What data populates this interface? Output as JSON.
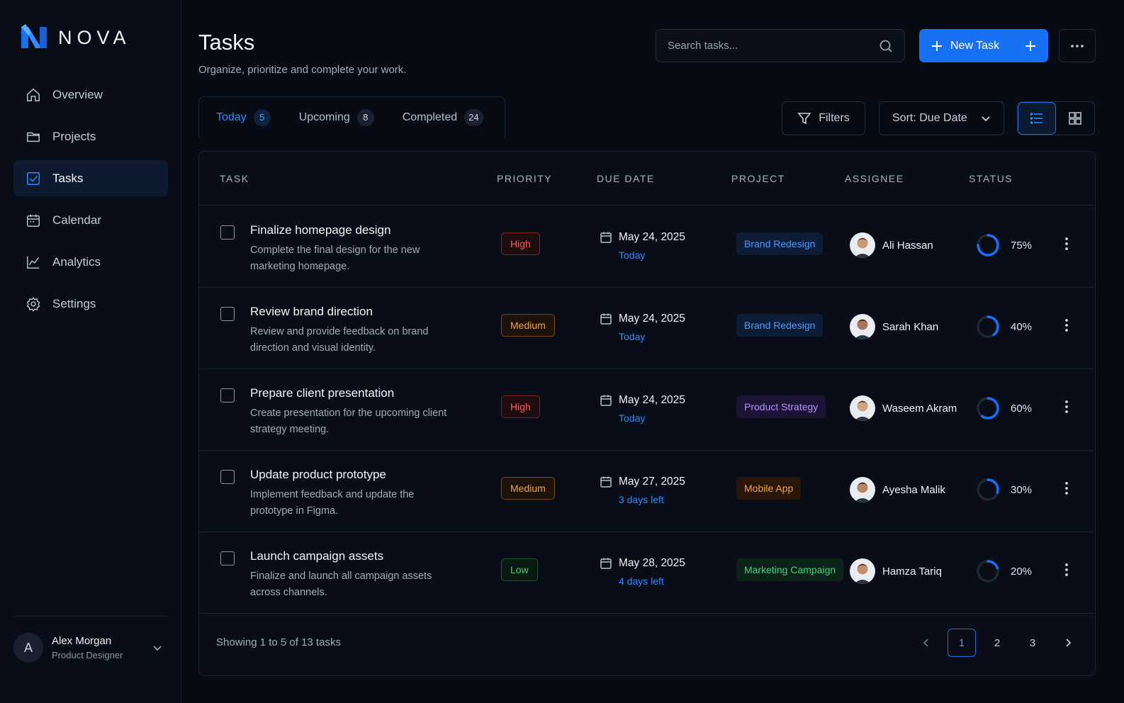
{
  "brand": {
    "name": "NOVA"
  },
  "sidebar": {
    "items": [
      {
        "label": "Overview",
        "icon": "home-icon"
      },
      {
        "label": "Projects",
        "icon": "folder-icon"
      },
      {
        "label": "Tasks",
        "icon": "checkbox-icon",
        "active": true
      },
      {
        "label": "Calendar",
        "icon": "calendar-icon"
      },
      {
        "label": "Analytics",
        "icon": "chart-icon"
      },
      {
        "label": "Settings",
        "icon": "gear-icon"
      }
    ],
    "user": {
      "initial": "A",
      "name": "Alex Morgan",
      "role": "Product Designer"
    }
  },
  "header": {
    "title": "Tasks",
    "subtitle": "Organize, prioritize and complete your work.",
    "search_placeholder": "Search tasks...",
    "new_task_label": "New Task"
  },
  "tabs": [
    {
      "label": "Today",
      "count": "5",
      "active": true
    },
    {
      "label": "Upcoming",
      "count": "8"
    },
    {
      "label": "Completed",
      "count": "24"
    }
  ],
  "toolbar": {
    "filters_label": "Filters",
    "sort_label": "Sort: Due Date"
  },
  "table": {
    "columns": [
      "TASK",
      "PRIORITY",
      "DUE DATE",
      "PROJECT",
      "ASSIGNEE",
      "STATUS"
    ],
    "rows": [
      {
        "title": "Finalize homepage design",
        "desc": "Complete the final design for the new marketing homepage.",
        "priority": "High",
        "due": "May 24, 2025",
        "due_rel": "Today",
        "project": "Brand Redesign",
        "assignee": "Ali Hassan",
        "status": "75%",
        "progress": 0.75
      },
      {
        "title": "Review brand direction",
        "desc": "Review and provide feedback on brand direction and visual identity.",
        "priority": "Medium",
        "due": "May 24, 2025",
        "due_rel": "Today",
        "project": "Brand Redesign",
        "assignee": "Sarah Khan",
        "status": "40%",
        "progress": 0.4
      },
      {
        "title": "Prepare client presentation",
        "desc": "Create presentation for the upcoming client strategy meeting.",
        "priority": "High",
        "due": "May 24, 2025",
        "due_rel": "Today",
        "project": "Product Strategy",
        "assignee": "Waseem Akram",
        "status": "60%",
        "progress": 0.6
      },
      {
        "title": "Update product prototype",
        "desc": "Implement feedback and update the prototype in Figma.",
        "priority": "Medium",
        "due": "May 27, 2025",
        "due_rel": "3 days left",
        "project": "Mobile App",
        "assignee": "Ayesha Malik",
        "status": "30%",
        "progress": 0.3
      },
      {
        "title": "Launch campaign assets",
        "desc": "Finalize and launch all campaign assets across channels.",
        "priority": "Low",
        "due": "May 28, 2025",
        "due_rel": "4 days left",
        "project": "Marketing Campaign",
        "assignee": "Hamza Tariq",
        "status": "20%",
        "progress": 0.2
      }
    ]
  },
  "footer": {
    "showing": "Showing 1 to 5 of 13 tasks",
    "pages": [
      "1",
      "2",
      "3"
    ],
    "current_page": "1"
  },
  "colors": {
    "accent": "#1672f3",
    "background": "#070b14",
    "high": "#ff5b5b",
    "medium": "#f6a23a",
    "low": "#3ed27a"
  }
}
